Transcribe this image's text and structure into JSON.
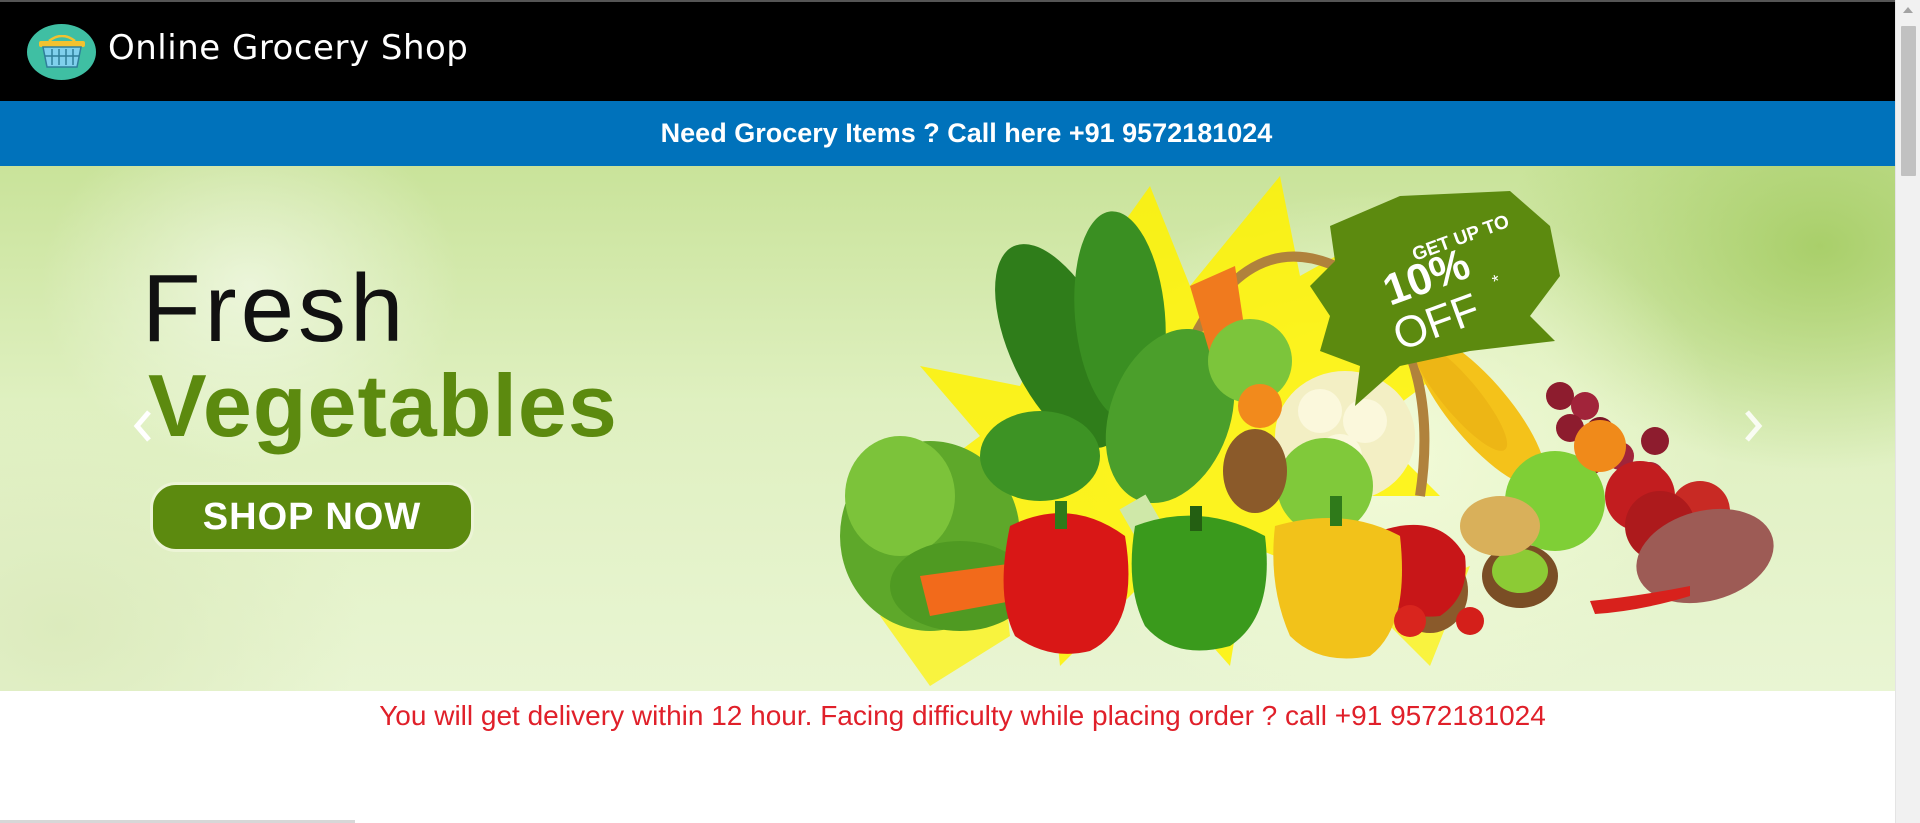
{
  "header": {
    "logo_icon": "shopping-basket-icon",
    "brand_title": "Online Grocery Shop",
    "background_color": "#000000"
  },
  "callbar": {
    "text": "Need Grocery Items ? Call here +91 9572181024",
    "background_color": "#0072bb"
  },
  "hero": {
    "headline_line1": "Fresh",
    "headline_line2": "Vegetables",
    "cta_label": "SHOP NOW",
    "badge_line1": "GET UP TO",
    "badge_line2": "10%",
    "badge_line3": "OFF",
    "badge_asterisk": "*",
    "accent_color": "#5c8a0f",
    "prev_icon": "chevron-left-icon",
    "next_icon": "chevron-right-icon"
  },
  "notice": {
    "text": "You will get delivery within 12 hour. Facing difficulty while placing order ? call +91 9572181024",
    "color": "#e0202a"
  }
}
